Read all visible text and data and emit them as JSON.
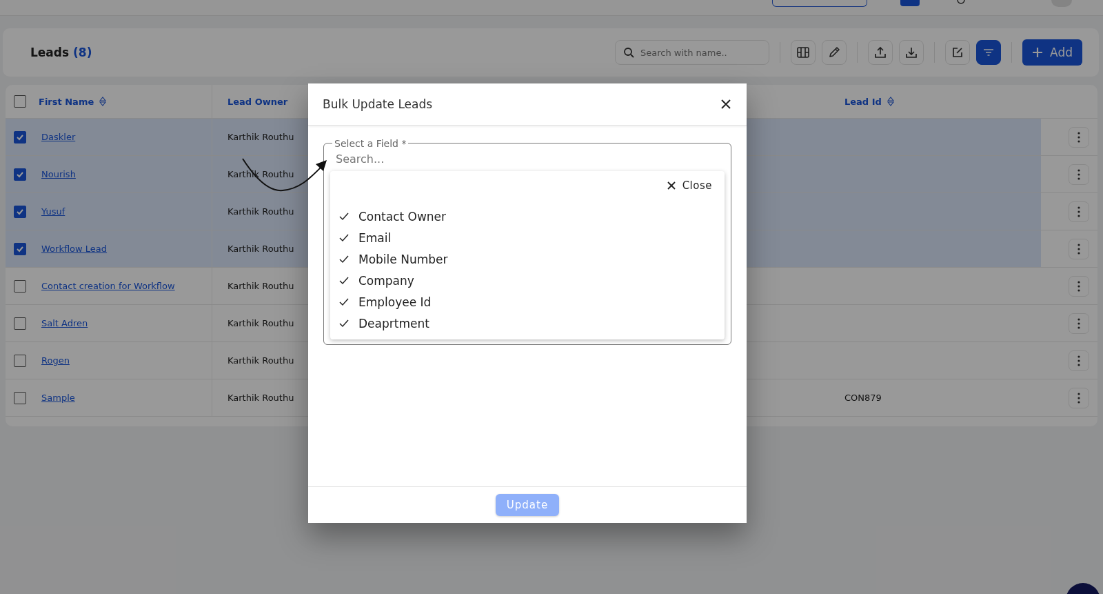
{
  "page_title": {
    "label": "Leads",
    "count": "(8)"
  },
  "toolbar": {
    "search": {
      "placeholder": "Search with name.."
    },
    "filter_active": true,
    "add_button": {
      "label": "Add"
    }
  },
  "table": {
    "all_selected": false,
    "columns": [
      {
        "label": "First Name",
        "sortable": true
      },
      {
        "label": "Lead Owner",
        "sortable": false
      },
      {
        "label": "Lead Id",
        "sortable": true
      }
    ],
    "rows": [
      {
        "first_name": "Daskler",
        "lead_owner": "Karthik Routhu",
        "selected": true
      },
      {
        "first_name": "Nourish",
        "lead_owner": "Karthik Routhu",
        "selected": true
      },
      {
        "first_name": "Yusuf",
        "lead_owner": "Karthik Routhu",
        "selected": true
      },
      {
        "first_name": "Workflow Lead",
        "lead_owner": "Karthik Routhu",
        "selected": true
      },
      {
        "first_name": "Contact creation for Workflow",
        "lead_owner": "Karthik Routhu",
        "selected": false
      },
      {
        "first_name": "Salt Adren",
        "lead_owner": "Karthik Routhu",
        "selected": false
      },
      {
        "first_name": "Rogen",
        "lead_owner": "Karthik Routhu",
        "selected": false
      },
      {
        "first_name": "Sample",
        "lead_owner": "Karthik Routhu",
        "lead_id": "CON879",
        "selected": false
      }
    ]
  },
  "modal": {
    "title": "Bulk Update Leads",
    "field": {
      "label": "Select a Field *",
      "placeholder": "Search..."
    },
    "dropdown": {
      "close_label": "Close",
      "options": [
        {
          "label": "Contact Owner",
          "checked": true
        },
        {
          "label": "Email",
          "checked": true
        },
        {
          "label": "Mobile Number",
          "checked": true
        },
        {
          "label": "Company",
          "checked": true
        },
        {
          "label": "Employee Id",
          "checked": true
        },
        {
          "label": "Deaprtment",
          "checked": true
        }
      ]
    },
    "update_button": {
      "label": "Update",
      "disabled": true
    }
  }
}
